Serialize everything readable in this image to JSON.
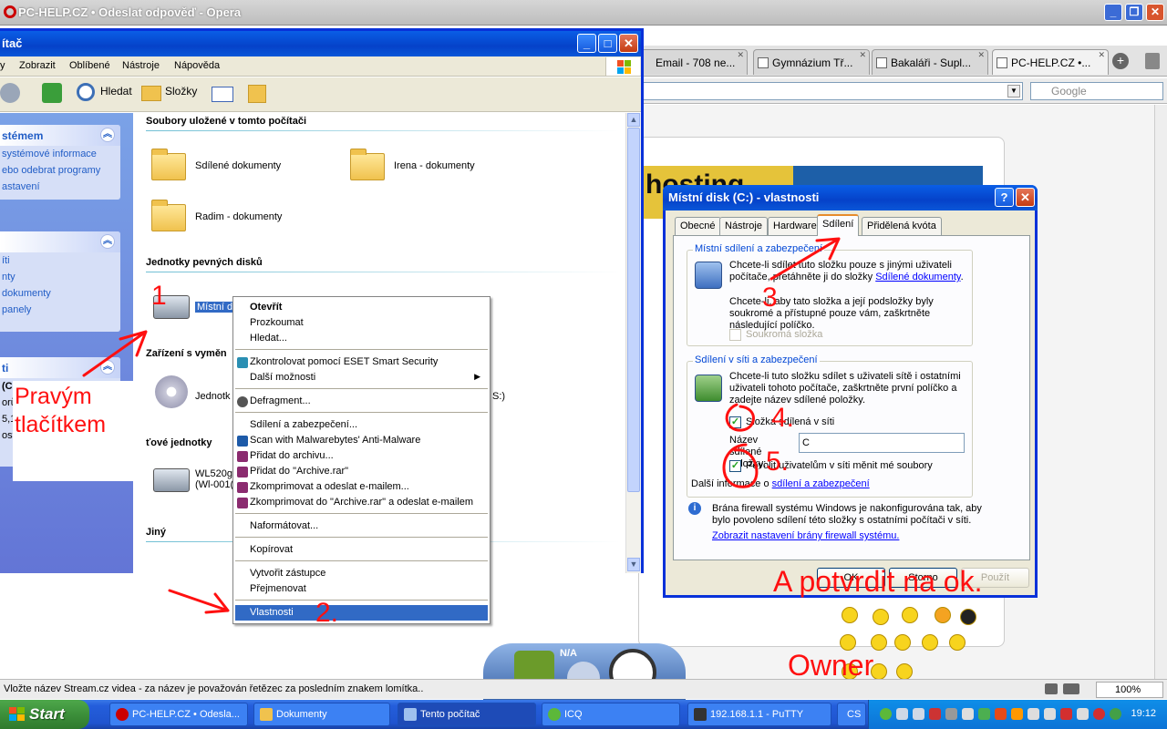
{
  "opera": {
    "title": "PC-HELP.CZ • Odeslat odpověď - Opera",
    "tabs": [
      "Email - 708 ne...",
      "Gymnázium Tř...",
      "Bakaláři - Supl...",
      "PC-HELP.CZ •..."
    ],
    "search_placeholder": "Google",
    "status_text": "Vložte název Stream.cz videa - za název je považován řetězec za posledním znakem lomítka..",
    "zoom": "100%",
    "banner_text": "hosting",
    "gadget_label": "N/A"
  },
  "explorer": {
    "title": "ítač",
    "menu": [
      "y",
      "Zobrazit",
      "Oblíbené",
      "Nástroje",
      "Nápověda"
    ],
    "toolbar": {
      "search": "Hledat",
      "folders": "Složky"
    },
    "left_panels": [
      {
        "title": "stémem",
        "links": [
          "systémové informace",
          "ebo odebrat programy",
          "astavení"
        ]
      },
      {
        "title": "",
        "links": [
          "íti",
          "nty",
          "dokumenty",
          "panely"
        ]
      },
      {
        "title": "ti",
        "links": [
          "(C:",
          "orů",
          "5,1",
          "ost"
        ]
      }
    ],
    "groups": {
      "stored": "Soubory uložené v tomto počítači",
      "hdd": "Jednotky pevných disků",
      "removable": "Zařízení s vyměn",
      "network": "ťové jednotky",
      "other": "Jiný"
    },
    "items": {
      "shared": "Sdílené dokumenty",
      "irena": "Irena - dokumenty",
      "radim": "Radim - dokumenty",
      "local_disk": "Místní di",
      "cd": "Jednotk",
      "cd_suffix": "S:)",
      "wl": "WL520g",
      "wl2": "(Wl-001("
    }
  },
  "context_menu": {
    "items": [
      "Otevřít",
      "Prozkoumat",
      "Hledat...",
      "Zkontrolovat pomocí ESET Smart Security",
      "Další možnosti",
      "Defragment...",
      "Sdílení a zabezpečení...",
      "Scan with Malwarebytes' Anti-Malware",
      "Přidat do archivu...",
      "Přidat do \"Archive.rar\"",
      "Zkomprimovat a odeslat e-mailem...",
      "Zkomprimovat do \"Archive.rar\" a odeslat e-mailem",
      "Naformátovat...",
      "Kopírovat",
      "Vytvořit zástupce",
      "Přejmenovat",
      "Vlastnosti"
    ]
  },
  "dialog": {
    "title": "Místní disk (C:) - vlastnosti",
    "tabs": [
      "Obecné",
      "Nástroje",
      "Hardware",
      "Sdílení",
      "Přidělená kvóta"
    ],
    "local_group": "Místní sdílení a zabezpečení",
    "local_text1": "Chcete-li sdílet tuto složku pouze s jinými uživateli počítače, přetáhněte ji do složky",
    "local_link": "Sdílené dokumenty",
    "local_text2": "Chcete-li, aby tato složka a její podsložky byly soukromé a přístupné pouze vám, zaškrtněte následující políčko.",
    "private_label": "Soukromá složka",
    "net_group": "Sdílení v síti a zabezpečení",
    "net_text": "Chcete-li tuto složku sdílet s uživateli sítě i ostatními uživateli tohoto počítače, zaškrtněte první políčko a zadejte název sdílené položky.",
    "share_label": "Složka sdílená v síti",
    "share_name_label": "Název sdílené položky:",
    "share_name_value": "C",
    "allow_label": "Povolit uživatelům v síti měnit mé soubory",
    "more_info": "Další informace o",
    "more_link": "sdílení a zabezpečení",
    "fw_text": "Brána firewall systému Windows je nakonfigurována tak, aby bylo povoleno sdílení této složky s ostatními počítači v síti.",
    "fw_link": "Zobrazit nastavení brány firewall systému.",
    "ok": "OK",
    "cancel": "Storno",
    "apply": "Použít"
  },
  "annotations": {
    "n1": "1",
    "n2": "2.",
    "n3": "3",
    "n4": "4.",
    "n5": "5.",
    "right_click": "Pravým tlačítkem",
    "confirm": "A potvrdit na ok.",
    "owner": "Owner"
  },
  "taskbar": {
    "start": "Start",
    "tasks": [
      "PC-HELP.CZ • Odesla...",
      "Dokumenty",
      "Tento počítač",
      "ICQ",
      "192.168.1.1 - PuTTY",
      "CS"
    ],
    "clock": "19:12"
  },
  "colors": {
    "xp_blue": "#0a5ee6",
    "annotation_red": "#ff1010",
    "menu_highlight": "#316ac5"
  }
}
